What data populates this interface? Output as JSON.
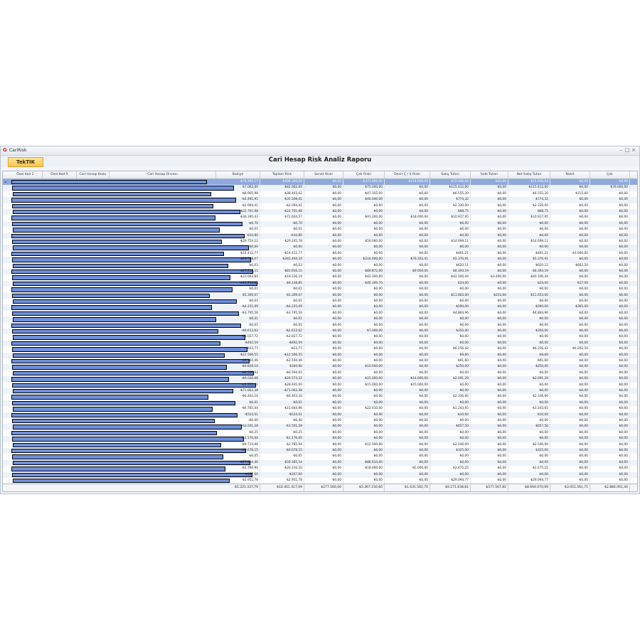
{
  "window": {
    "app_title": "CariRisk",
    "logo": "G"
  },
  "toolbar": {
    "tab_label": "TekTIK",
    "report_title": "Cari Hesap Risk Analiz Raporu"
  },
  "columns": [
    "Özel Kod 2",
    "Özel Kod 5",
    "Cari Hesap Kodu",
    "Cari Hesap Ünvanı",
    "Bakiye",
    "Toplam Risk",
    "Senet Riski",
    "Çek Riski",
    "Devir Ç / S Riski",
    "Satış Tutarı",
    "İade Tutarı",
    "Net Satış Tutarı",
    "Nakit",
    "Çek"
  ],
  "rows": [
    [
      "-₺76.265,17",
      "₺408.300,00",
      "₺0,00",
      "₺371.000,00",
      "₺114.000,00",
      "₺15.046,04",
      "₺10,00",
      "₺15.036,04",
      "₺0,00",
      "₺0,00"
    ],
    [
      "₺7.062,00",
      "₺82.062,00",
      "₺0,00",
      "₺75.000,00",
      "₺0,00",
      "₺115.412,00",
      "₺0,00",
      "₺115.412,00",
      "₺0,00",
      "₺76.000,00"
    ],
    [
      "-₺8.905,98",
      "₺38.403,02",
      "₺0,00",
      "₺47.355,00",
      "₺0,00",
      "₺6.555,20",
      "₺0,00",
      "₺6.555,20",
      "₺115,00",
      "₺0,00"
    ],
    [
      "-₺4.491,95",
      "₺35.508,05",
      "₺0,00",
      "₺40.000,00",
      "₺0,00",
      "₺774,32",
      "₺0,00",
      "₺774,32",
      "₺0,00",
      "₺0,00"
    ],
    [
      "-₺2.094,41",
      "-₺2.094,41",
      "₺0,00",
      "₺0,00",
      "₺0,00",
      "₺2.330,00",
      "₺0,00",
      "₺2.330,00",
      "₺0,00",
      "₺0,00"
    ],
    [
      "-₺22.701,98",
      "-₺22.701,98",
      "₺0,00",
      "₺0,00",
      "₺0,00",
      "₺68,75",
      "₺0,00",
      "₺68,75",
      "₺0,00",
      "₺0,00"
    ],
    [
      "-₺36.395,43",
      "₺72.604,57",
      "₺0,00",
      "₺91.200,00",
      "₺18.000,00",
      "₺10.917,95",
      "₺0,00",
      "₺10.917,95",
      "₺0,00",
      "₺0,00"
    ],
    [
      "-₺0,70",
      "-₺0,70",
      "₺0,00",
      "₺0,00",
      "₺0,00",
      "₺0,00",
      "₺0,00",
      "₺0,00",
      "₺0,00",
      "₺0,00"
    ],
    [
      "₺0,01",
      "₺0,01",
      "₺0,00",
      "₺0,00",
      "₺0,00",
      "₺0,00",
      "₺0,00",
      "₺0,00",
      "₺0,00",
      "₺0,00"
    ],
    [
      "-₺10,80",
      "-₺10,80",
      "₺0,00",
      "₺0,00",
      "₺0,00",
      "₺0,00",
      "₺0,00",
      "₺0,00",
      "₺0,00",
      "₺0,00"
    ],
    [
      "-₺29.754,22",
      "₺20.245,78",
      "₺0,00",
      "₺50.000,00",
      "₺0,00",
      "₺14.699,11",
      "₺0,00",
      "₺14.699,11",
      "₺0,00",
      "₺0,00"
    ],
    [
      "₺0,00",
      "₺0,00",
      "₺0,00",
      "₺0,00",
      "₺0,00",
      "₺0,00",
      "₺0,00",
      "₺0,00",
      "₺0,00",
      "₺0,00"
    ],
    [
      "-₺14.412,77",
      "-₺14.412,77",
      "₺0,00",
      "₺0,00",
      "₺0,00",
      "₺461,21",
      "₺0,00",
      "₺461,21",
      "₺3.000,00",
      "₺0,00"
    ],
    [
      "-₺29.708,07",
      "₺265.494,34",
      "₺0,00",
      "₺216.000,00",
      "₺79.202,41",
      "₺5.370,91",
      "₺0,00",
      "₺5.370,91",
      "₺0,00",
      "₺0,00"
    ],
    [
      "₺0,03",
      "₺0,03",
      "₺0,00",
      "₺0,00",
      "₺0,00",
      "₺620,11",
      "₺0,00",
      "₺620,11",
      "₺602,50",
      "₺0,00"
    ],
    [
      "-₺17.216,15",
      "₺81.656,15",
      "₺0,00",
      "₺89.872,00",
      "₺9.000,00",
      "₺6.393,19",
      "₺0,00",
      "₺6.393,19",
      "₺0,00",
      "₺0,00"
    ],
    [
      "-₺23.063,81",
      "₺19.236,19",
      "₺0,00",
      "₺42.300,00",
      "₺0,00",
      "₺42.500,44",
      "₺3.400,00",
      "₺40.100,44",
      "₺0,00",
      "₺0,00"
    ],
    [
      "-₺31.210,85",
      "₺9.138,85",
      "₺0,00",
      "₺40.349,70",
      "₺0,00",
      "₺24,00",
      "₺0,00",
      "₺24,00",
      "₺17,00",
      "₺0,00"
    ],
    [
      "₺0,01",
      "₺0,01",
      "₺0,00",
      "₺0,00",
      "₺0,00",
      "₺0,00",
      "₺0,00",
      "₺0,00",
      "₺0,00",
      "₺0,00"
    ],
    [
      "₺5.309,07",
      "₺5.309,07",
      "₺0,00",
      "₺0,00",
      "₺0,00",
      "₺11.863,00",
      "₺210,00",
      "₺11.653,00",
      "₺0,00",
      "₺0,00"
    ],
    [
      "₺0,01",
      "₺0,01",
      "₺0,00",
      "₺0,00",
      "₺0,00",
      "₺0,00",
      "₺0,00",
      "₺0,00",
      "₺0,00",
      "₺0,00"
    ],
    [
      "-₺4.225,09",
      "-₺4.225,09",
      "₺0,00",
      "₺0,00",
      "₺0,00",
      "₺590,00",
      "₺0,00",
      "₺590,00",
      "₺365,00",
      "₺0,00"
    ],
    [
      "-₺3.795,56",
      "-₺3.795,56",
      "₺0,00",
      "₺0,00",
      "₺0,00",
      "₺4.864,96",
      "₺0,00",
      "₺4.864,96",
      "₺0,00",
      "₺0,00"
    ],
    [
      "₺0,01",
      "₺0,01",
      "₺0,00",
      "₺0,00",
      "₺0,00",
      "₺0,00",
      "₺0,00",
      "₺0,00",
      "₺0,00",
      "₺0,00"
    ],
    [
      "₺0,01",
      "₺0,01",
      "₺0,00",
      "₺0,00",
      "₺0,00",
      "₺0,00",
      "₺0,00",
      "₺0,00",
      "₺0,00",
      "₺0,00"
    ],
    [
      "-₺9.613,62",
      "-₺2.613,62",
      "₺0,00",
      "₺7.000,00",
      "₺0,00",
      "₺350,00",
      "₺0,00",
      "₺350,00",
      "₺0,00",
      "₺0,00"
    ],
    [
      "-₺3.027,72",
      "-₺3.027,72",
      "₺0,00",
      "₺0,00",
      "₺0,00",
      "₺0,00",
      "₺0,00",
      "₺0,00",
      "₺0,00",
      "₺0,00"
    ],
    [
      "-₺492,59",
      "-₺492,59",
      "₺0,00",
      "₺0,00",
      "₺0,00",
      "₺0,00",
      "₺0,00",
      "₺0,00",
      "₺0,00",
      "₺0,00"
    ],
    [
      "-₺53,77",
      "-₺53,77",
      "₺0,00",
      "₺0,00",
      "₺0,00",
      "₺6.256,42",
      "₺0,00",
      "₺6.256,42",
      "₺6.262,50",
      "₺0,00"
    ],
    [
      "-₺12.506,55",
      "-₺12.506,55",
      "₺0,00",
      "₺0,00",
      "₺0,00",
      "₺9,60",
      "₺0,00",
      "₺9,60",
      "₺0,00",
      "₺0,00"
    ],
    [
      "-₺3.104,46",
      "-₺3.104,46",
      "₺0,00",
      "₺0,00",
      "₺0,00",
      "₺91,60",
      "₺0,00",
      "₺91,60",
      "₺0,00",
      "₺0,00"
    ],
    [
      "-₺9.839,10",
      "₺160,90",
      "₺0,00",
      "₺10.000,00",
      "₺0,00",
      "₺250,00",
      "₺0,00",
      "₺250,00",
      "₺0,00",
      "₺0,00"
    ],
    [
      "-₺6.594,02",
      "-₺6.594,02",
      "₺0,00",
      "₺0,00",
      "₺0,00",
      "₺0,00",
      "₺0,00",
      "₺0,00",
      "₺0,00",
      "₺0,00"
    ],
    [
      "-₺9.026,68",
      "₺20.573,32",
      "₺0,00",
      "₺15.000,00",
      "₺14.600,00",
      "₺2.091,29",
      "₺0,00",
      "₺2.091,29",
      "₺0,00",
      "₺0,00"
    ],
    [
      "-₺1.555,00",
      "₺28.445,00",
      "₺0,00",
      "₺15.000,00",
      "₺15.000,00",
      "₺0,00",
      "₺0,00",
      "₺0,00",
      "₺0,00",
      "₺0,00"
    ],
    [
      "-₺71.063,38",
      "-₺71.063,38",
      "₺0,00",
      "₺0,00",
      "₺0,00",
      "₺0,00",
      "₺0,00",
      "₺0,00",
      "₺0,00",
      "₺0,00"
    ],
    [
      "-₺6.403,10",
      "-₺6.403,10",
      "₺0,00",
      "₺0,00",
      "₺0,00",
      "₺2.336,60",
      "₺0,00",
      "₺2.336,60",
      "₺0,00",
      "₺0,00"
    ],
    [
      "₺0,01",
      "₺0,01",
      "₺0,00",
      "₺0,00",
      "₺0,00",
      "₺0,00",
      "₺0,00",
      "₺0,00",
      "₺0,00",
      "₺0,00"
    ],
    [
      "-₺6.765,04",
      "₺15.644,96",
      "₺0,00",
      "₺22.410,00",
      "₺0,00",
      "₺1.243,65",
      "₺0,00",
      "₺1.243,65",
      "₺0,00",
      "₺0,00"
    ],
    [
      "-₺524,01",
      "-₺524,01",
      "₺0,00",
      "₺0,00",
      "₺0,00",
      "₺10,00",
      "₺0,00",
      "₺10,00",
      "₺0,00",
      "₺0,00"
    ],
    [
      "-₺0,40",
      "-₺0,40",
      "₺0,00",
      "₺0,00",
      "₺0,00",
      "₺0,00",
      "₺0,00",
      "₺0,00",
      "₺0,00",
      "₺0,00"
    ],
    [
      "-₺3.501,28",
      "-₺3.501,28",
      "₺0,00",
      "₺0,00",
      "₺0,00",
      "₺657,50",
      "₺0,00",
      "₺657,50",
      "₺0,00",
      "₺0,00"
    ],
    [
      "₺0,25",
      "₺0,25",
      "₺0,00",
      "₺0,00",
      "₺0,00",
      "₺0,00",
      "₺0,00",
      "₺0,00",
      "₺0,00",
      "₺0,00"
    ],
    [
      "-₺1.176,00",
      "-₺1.176,00",
      "₺0,00",
      "₺0,00",
      "₺0,00",
      "₺0,00",
      "₺0,00",
      "₺0,00",
      "₺0,00",
      "₺0,00"
    ],
    [
      "-₺9.714,06",
      "₺2.785,94",
      "₺0,00",
      "₺12.500,00",
      "₺0,00",
      "₺2.540,00",
      "₺0,00",
      "₺2.540,00",
      "₺0,00",
      "₺0,00"
    ],
    [
      "-₺9.678,15",
      "-₺9.678,15",
      "₺0,00",
      "₺0,00",
      "₺0,00",
      "₺325,00",
      "₺0,00",
      "₺325,00",
      "₺0,00",
      "₺0,00"
    ],
    [
      "₺0,05",
      "₺0,05",
      "₺0,00",
      "₺0,00",
      "₺0,00",
      "₺0,00",
      "₺0,00",
      "₺0,00",
      "₺0,00",
      "₺0,00"
    ],
    [
      "-₺27.304,46",
      "₺59.305,54",
      "₺0,00",
      "₺86.610,00",
      "₺0,00",
      "₺0,00",
      "₺0,00",
      "₺0,00",
      "₺0,00",
      "₺0,00"
    ],
    [
      "-₺2.789,90",
      "₺20.210,10",
      "₺0,00",
      "₺18.000,00",
      "₺5.000,00",
      "₺2.475,25",
      "₺0,00",
      "₺2.475,25",
      "₺0,00",
      "₺0,00"
    ],
    [
      "-₺167,60",
      "-₺167,60",
      "₺0,00",
      "₺0,00",
      "₺0,00",
      "₺0,00",
      "₺0,00",
      "₺0,00",
      "₺0,00",
      "₺0,00"
    ],
    [
      "₺2.951,78",
      "₺2.951,78",
      "₺0,00",
      "₺0,00",
      "₺0,00",
      "₺29.094,77",
      "₺0,00",
      "₺29.094,77",
      "₺0,00",
      "₺0,00"
    ]
  ],
  "totals": [
    "₺5.225.337,79",
    "₺10.401.417,09",
    "₺277.566,00",
    "₺5.367.150,60",
    "₺1.631.562,70",
    "₺9.271.638,81",
    "₺577.567,82",
    "₺8.694.070,99",
    "₺3.051.561,71",
    "₺2.884.061,40"
  ],
  "colors": {
    "selected_row": "#8ea9dd",
    "alt_row": "#eef3fa",
    "redaction_fill": "#6f8fd8"
  }
}
